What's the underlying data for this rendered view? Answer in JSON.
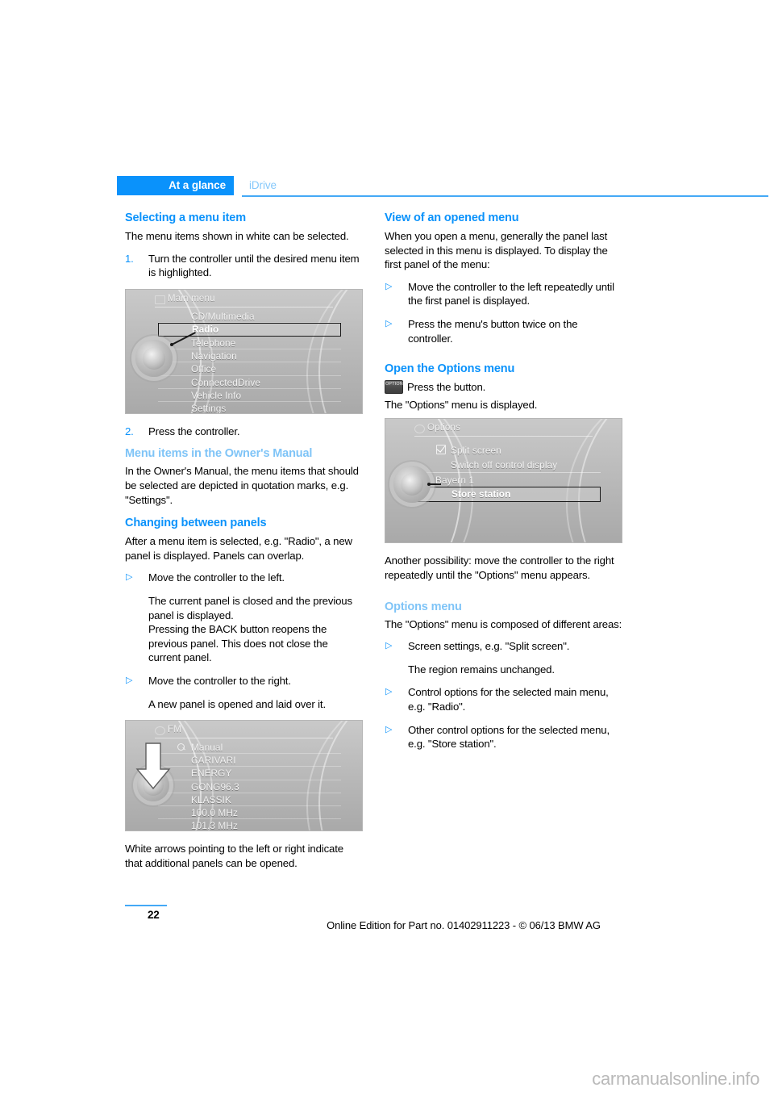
{
  "header": {
    "chapter_tab": "At a glance",
    "section": "iDrive"
  },
  "left_column": {
    "h_selecting": "Selecting a menu item",
    "p_selecting": "The menu items shown in white can be selected.",
    "step1_marker": "1.",
    "step1_text": "Turn the controller until the desired menu item is highlighted.",
    "figure_main_menu": {
      "title": "Main menu",
      "items": [
        "CD/Multimedia",
        "Radio",
        "Telephone",
        "Navigation",
        "Office",
        "ConnectedDrive",
        "Vehicle Info",
        "Settings"
      ],
      "selected_item": "Radio"
    },
    "step2_marker": "2.",
    "step2_text": "Press the controller.",
    "h_owners_manual": "Menu items in the Owner's Manual",
    "p_owners_manual": "In the Owner's Manual, the menu items that should be selected are depicted in quotation marks, e.g. \"Settings\".",
    "h_changing_panels": "Changing between panels",
    "p_changing_panels": "After a menu item is selected, e.g. \"Radio\", a new panel is displayed. Panels can overlap.",
    "bullet_left_text": "Move the controller to the left.",
    "bullet_left_sub": "The current panel is closed and the previous panel is displayed.\nPressing the BACK button reopens the previous panel. This does not close the current panel.",
    "bullet_right_text": "Move the controller to the right.",
    "bullet_right_sub": "A new panel is opened and laid over it.",
    "figure_fm": {
      "title": "FM",
      "manual_label": "Manual",
      "items": [
        "CARIVARI",
        "ENERGY",
        "GONG96.3",
        "KLASSIK",
        "100.0 MHz",
        "101.3 MHz"
      ]
    },
    "p_white_arrows": "White arrows pointing to the left or right indicate that additional panels can be opened."
  },
  "right_column": {
    "h_view_opened": "View of an opened menu",
    "p_view_opened": "When you open a menu, generally the panel last selected in this menu is displayed. To display the first panel of the menu:",
    "bullet_move_left": "Move the controller to the left repeatedly until the first panel is displayed.",
    "bullet_press_menu": "Press the menu's button twice on the controller.",
    "h_open_options": "Open the Options menu",
    "option_button_label": "OPTION",
    "p_press_button": "Press the button.",
    "p_options_displayed": "The \"Options\" menu is displayed.",
    "figure_options": {
      "title": "Options",
      "items": [
        "Split screen",
        "Switch off control display",
        "Bayern 1",
        "Store station"
      ],
      "selected_item": "Store station",
      "checkbox_item": "Split screen"
    },
    "p_another_possibility": "Another possibility: move the controller to the right repeatedly until the \"Options\" menu appears.",
    "h_options_menu": "Options menu",
    "p_options_composed": "The \"Options\" menu is composed of different areas:",
    "bullet_screen_settings": "Screen settings, e.g. \"Split screen\".",
    "bullet_screen_settings_sub": "The region remains unchanged.",
    "bullet_control_options": "Control options for the selected main menu, e.g. \"Radio\".",
    "bullet_other_options": "Other control options for the selected menu, e.g. \"Store station\"."
  },
  "footer": {
    "page_number": "22",
    "online_edition": "Online Edition for Part no. 01402911223 - © 06/13 BMW AG",
    "watermark": "carmanualsonline.info"
  },
  "markers": {
    "triangle": "▷"
  },
  "colors": {
    "accent_blue": "#0a92fb",
    "light_blue": "#7fc4f7",
    "rule_blue": "#44a9f6"
  }
}
